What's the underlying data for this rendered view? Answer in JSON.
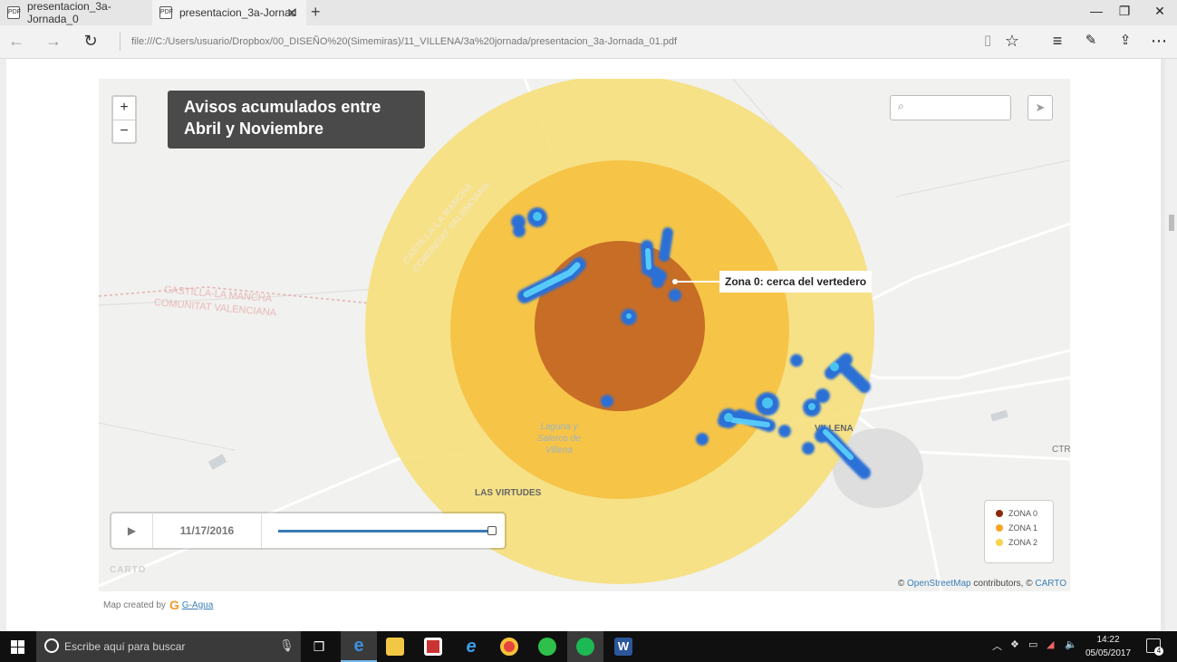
{
  "browser": {
    "tabs": [
      {
        "label": "presentacion_3a-Jornada_0",
        "active": false
      },
      {
        "label": "presentacion_3a-Jornad",
        "active": true
      }
    ],
    "address": "file:///C:/Users/usuario/Dropbox/00_DISEÑO%20(Simemiras)/11_VILLENA/3a%20jornada/presentacion_3a-Jornada_01.pdf"
  },
  "map": {
    "title_line1": "Avisos acumulados entre",
    "title_line2": "Abril y Noviembre",
    "zoom_in": "+",
    "zoom_out": "−",
    "annotation": "Zona 0: cerca del vertedero",
    "region_label_1a": "CASTILLA-LA MANCHA",
    "region_label_1b": "COMUNITAT VALENCIANA",
    "region_label_2a": "CASTILLA-LA MANCHA",
    "region_label_2b": "COMUNITAT VALENCIANA",
    "place_laguna_1": "Laguna y",
    "place_laguna_2": "Saleros de",
    "place_laguna_3": "Villena",
    "place_villena": "VILLENA",
    "place_virtudes": "LAS VIRTUDES",
    "place_ctr": "CTR",
    "timeline_date": "11/17/2016",
    "timeline_progress": 1.0,
    "legend": [
      {
        "label": "ZONA 0",
        "color": "#8b2a0c"
      },
      {
        "label": "ZONA 1",
        "color": "#f5a623"
      },
      {
        "label": "ZONA 2",
        "color": "#f8d44a"
      }
    ],
    "watermark": "CARTO",
    "attribution_prefix": "©",
    "attribution_osm": "OpenStreetMap",
    "attribution_mid": "contributors, ©",
    "attribution_carto": "CARTO",
    "credit_prefix": "Map created by",
    "credit_link": "G-Agua"
  },
  "taskbar": {
    "search_placeholder": "Escribe aquí para buscar",
    "time": "14:22",
    "date": "05/05/2017",
    "notifications": "4"
  }
}
